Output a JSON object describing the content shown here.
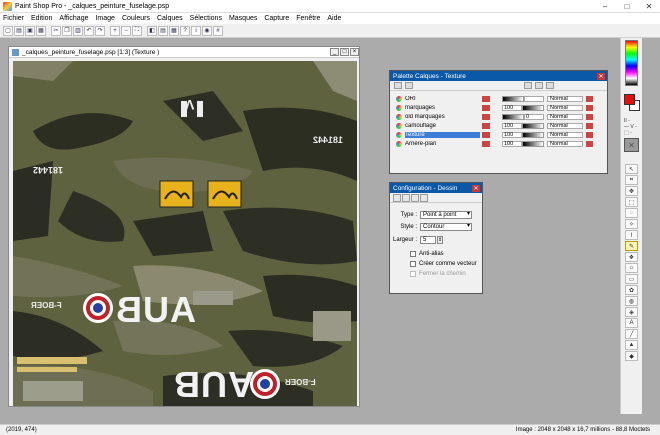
{
  "app": {
    "title": "Paint Shop Pro - _calques_peinture_fuselage.psp"
  },
  "window_controls": [
    "–",
    "□",
    "✕"
  ],
  "menu": [
    "Fichier",
    "Edition",
    "Affichage",
    "Image",
    "Couleurs",
    "Calques",
    "Sélections",
    "Masques",
    "Capture",
    "Fenêtre",
    "Aide"
  ],
  "toolbar_icons": [
    "new-icon",
    "open-icon",
    "save-icon",
    "print-icon",
    "cut-icon",
    "copy-icon",
    "paste-icon",
    "undo-icon",
    "redo-icon",
    "zoom-in-icon",
    "zoom-out-icon",
    "fullscreen-icon",
    "palette-icon",
    "layers-icon",
    "browse-icon",
    "help-icon",
    "info-icon",
    "capture-icon",
    "grid-icon"
  ],
  "image_window": {
    "title": "_calques_peinture_fuselage.psp [1:3] (Texture )"
  },
  "canvas_text": {
    "serial_top": "181442",
    "serial_left": "181442",
    "serial_mid": "181442",
    "aub_top": "AUB",
    "reg_top": "F-BOER",
    "aub_bottom": "AUB",
    "reg_bottom": "F-BOER",
    "v_mark": "V"
  },
  "layers_palette": {
    "title": "Palette Calques - Texture",
    "close": "✕",
    "layers": [
      {
        "name": "ORI",
        "opacity": "",
        "mode": "Normal",
        "selected": false
      },
      {
        "name": "marquages",
        "opacity": "100",
        "mode": "Normal",
        "selected": false
      },
      {
        "name": "old marquages",
        "opacity": "0",
        "mode": "Normal",
        "selected": false
      },
      {
        "name": "camouflage",
        "opacity": "100",
        "mode": "Normal",
        "selected": false
      },
      {
        "name": "Texture",
        "opacity": "100",
        "mode": "Normal",
        "selected": true
      },
      {
        "name": "Arrière-plan",
        "opacity": "100",
        "mode": "Normal",
        "selected": false
      }
    ]
  },
  "config_palette": {
    "title": "Configuration - Dessin",
    "close": "✕",
    "type_label": "Type :",
    "type_value": "Point à point",
    "style_label": "Style :",
    "style_value": "Contour",
    "width_label": "Largeur :",
    "width_value": "5",
    "antialias": "Anti-alias",
    "vector": "Créer comme vecteur",
    "close_path": "Fermer la chemin"
  },
  "tool_options_text": "II -\n— V -\n⬚ -",
  "tools": [
    "pointer-icon",
    "crop-icon",
    "move-icon",
    "select-icon",
    "lasso-icon",
    "wand-icon",
    "dropper-icon",
    "brush-icon",
    "clone-icon",
    "retouch-icon",
    "eraser-icon",
    "picture-tube-icon",
    "airbrush-icon",
    "fill-icon",
    "text-icon",
    "line-icon",
    "shape-icon",
    "vector-icon"
  ],
  "status": {
    "coords": "(2019, 474)",
    "info": "Image : 2048 x 2048 x 16,7 millions - 88,8 Moctets"
  }
}
